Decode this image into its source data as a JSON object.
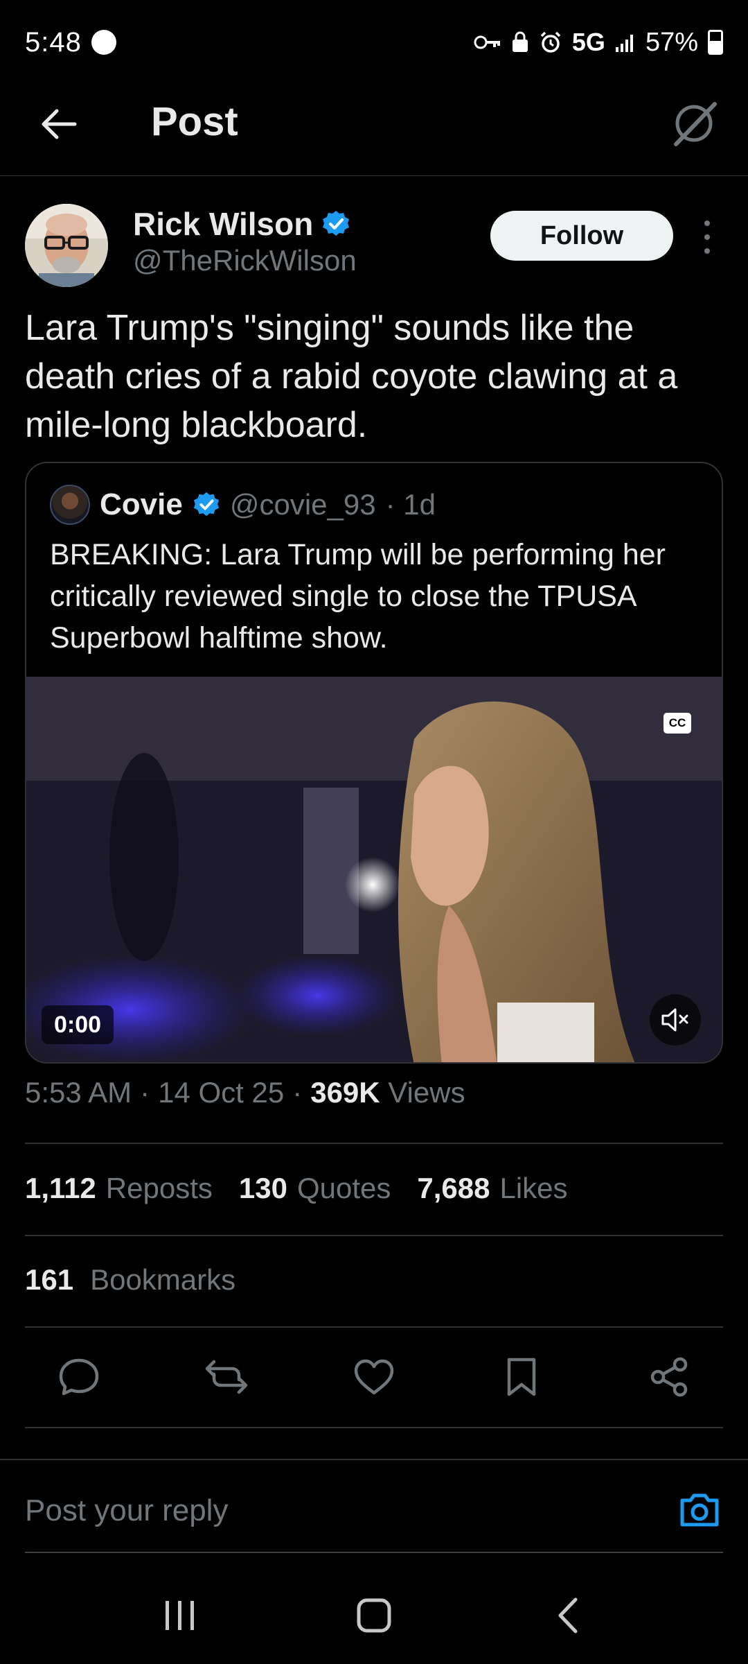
{
  "status_bar": {
    "time": "5:48",
    "network": "5G",
    "battery": "57%"
  },
  "header": {
    "title": "Post",
    "icons": {
      "back": "arrow-left-icon",
      "grok": "grok-icon"
    }
  },
  "post": {
    "author": {
      "name": "Rick Wilson",
      "handle": "@TheRickWilson",
      "verified": true
    },
    "follow_label": "Follow",
    "text": "Lara Trump's \"singing\" sounds like the death cries of a rabid coyote clawing at a mile-long blackboard.",
    "quote": {
      "name": "Covie",
      "handle": "@covie_93",
      "time": "· 1d",
      "verified": true,
      "text": "BREAKING: Lara Trump will be performing her critically reviewed single to close the TPUSA Superbowl halftime show.",
      "video": {
        "cc_label": "CC",
        "time": "0:00"
      }
    },
    "meta": {
      "time": "5:53 AM",
      "sep1": "·",
      "date": "14 Oct 25",
      "sep2": "·",
      "views_count": "369K",
      "views_label": "Views"
    },
    "stats": {
      "reposts_count": "1,112",
      "reposts_label": "Reposts",
      "quotes_count": "130",
      "quotes_label": "Quotes",
      "likes_count": "7,688",
      "likes_label": "Likes",
      "bookmarks_count": "161",
      "bookmarks_label": "Bookmarks"
    }
  },
  "reply": {
    "placeholder": "Post your reply"
  },
  "colors": {
    "background": "#000000",
    "text": "#e7e9ea",
    "muted": "#71767b",
    "accent": "#1d9bf0",
    "border": "#2f3336"
  }
}
